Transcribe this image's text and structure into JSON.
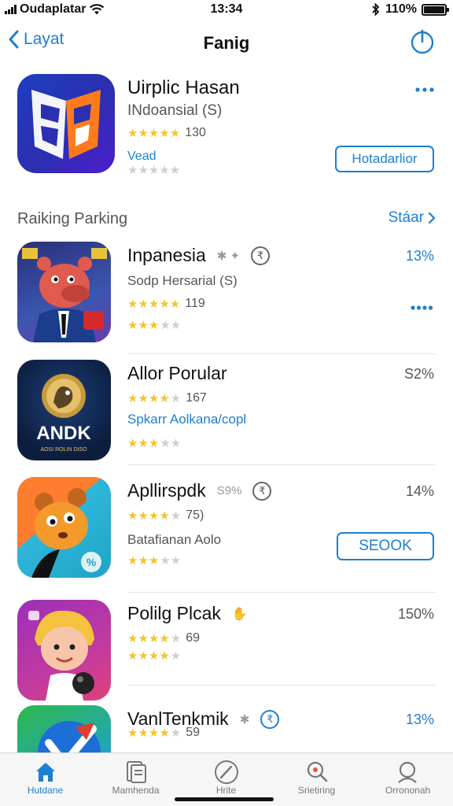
{
  "status_bar": {
    "carrier": "Oudaplatar",
    "time": "13:34",
    "battery": "110%"
  },
  "nav": {
    "back_label": "Layat",
    "title": "Fanig"
  },
  "featured": {
    "name": "Uirplic Hasan",
    "subtitle": "INdoansial (S)",
    "rating_count": "130",
    "tag": "Vead",
    "button_label": "Hotadarlior"
  },
  "section": {
    "title": "Raiking Parking",
    "link_label": "Stáar"
  },
  "apps": [
    {
      "name": "Inpanesia",
      "percent": "13%",
      "subtitle": "Sodp Hersarial (S)",
      "rating_count": "119"
    },
    {
      "name": "Allor Porular",
      "percent": "S2%",
      "rating_count": "167",
      "link_text": "Spkarr Aolkana/copl"
    },
    {
      "name": "Apllirspdk",
      "name_extra": "S9%",
      "percent": "14%",
      "rating_count": "75)",
      "subtitle": "Batafianan Aolo",
      "button_label": "SEOOK"
    },
    {
      "name": "Polilg Plcak",
      "percent": "150%",
      "rating_count": "69"
    },
    {
      "name": "VanlTenkmik",
      "percent": "13%",
      "rating_count": "59"
    }
  ],
  "icon_texts": {
    "andk": "ANDK",
    "andk_sub": "AOSI ROLIN DISO",
    "badge": "%"
  },
  "tabbar": [
    {
      "label": "Hutdane",
      "icon": "home-icon",
      "active": true
    },
    {
      "label": "Mamhenda",
      "icon": "documents-icon"
    },
    {
      "label": "Hrite",
      "icon": "compass-icon"
    },
    {
      "label": "Srietiring",
      "icon": "search-icon"
    },
    {
      "label": "Orrononah",
      "icon": "account-search-icon"
    }
  ],
  "colors": {
    "accent": "#1d7fd0",
    "star": "#f2c530",
    "text": "#111111"
  }
}
